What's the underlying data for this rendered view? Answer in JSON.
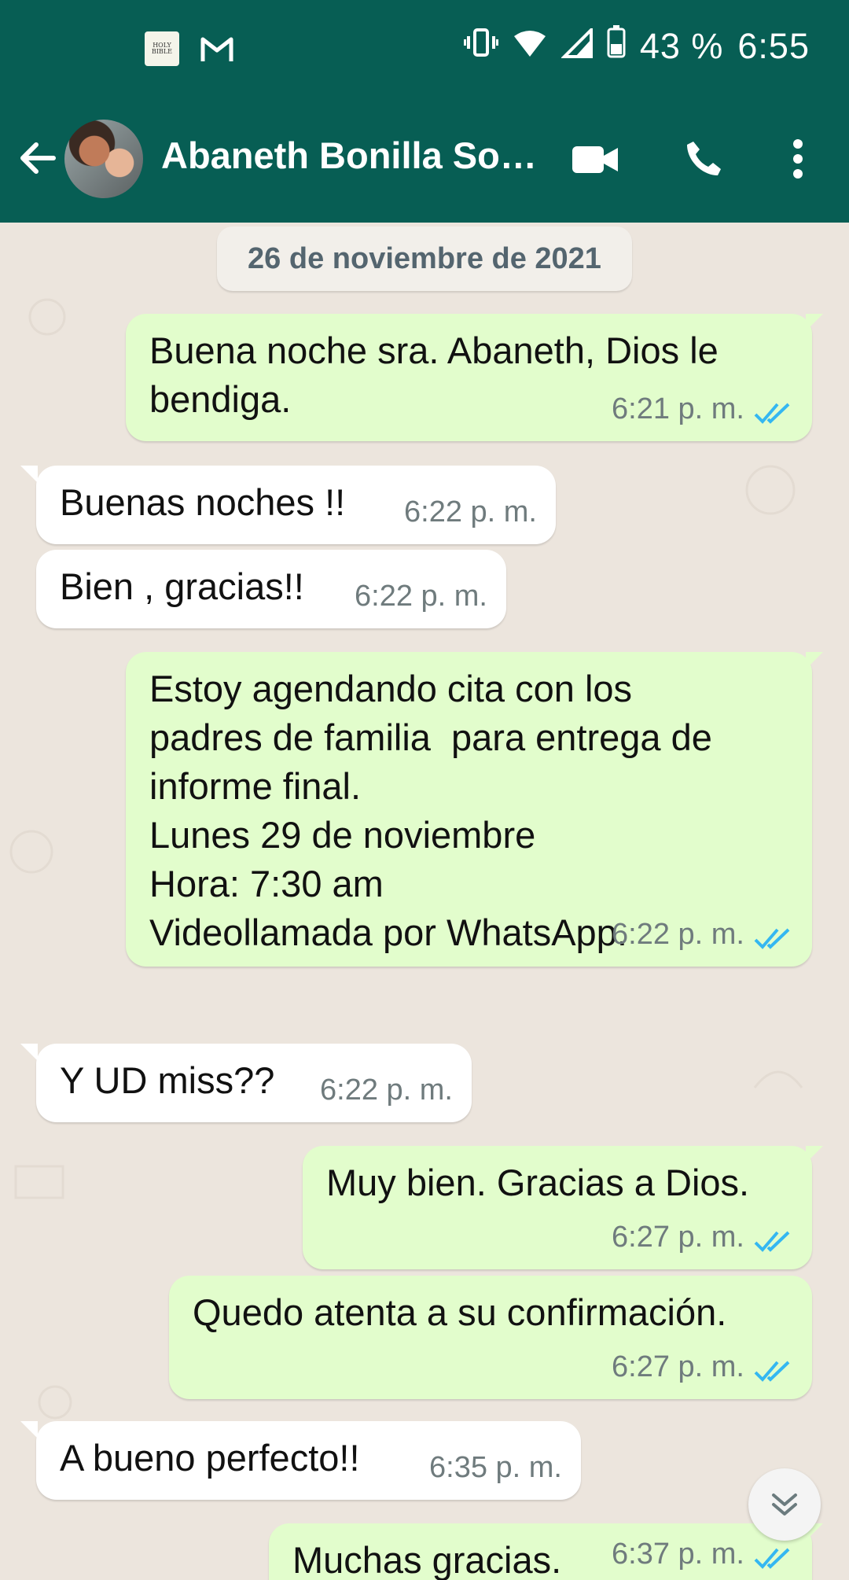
{
  "status_bar": {
    "battery": "43 %",
    "time": "6:55",
    "bible_icon_text": "HOLY BIBLE"
  },
  "header": {
    "contact_name": "Abaneth Bonilla So…"
  },
  "chat": {
    "date_chip": "26 de noviembre de 2021",
    "messages": [
      {
        "dir": "out",
        "text": "Buena noche sra. Abaneth, Dios le\nbendiga.",
        "time": "6:21 p. m.",
        "read": true
      },
      {
        "dir": "in",
        "text": "Buenas noches !!",
        "time": "6:22 p. m."
      },
      {
        "dir": "in",
        "text": "Bien , gracias!!",
        "time": "6:22 p. m."
      },
      {
        "dir": "out",
        "text": "Estoy agendando cita con los\npadres de familia  para entrega de\ninforme final.\nLunes 29 de noviembre\nHora: 7:30 am\nVideollamada por WhatsApp.",
        "time": "6:22 p. m.",
        "read": true
      },
      {
        "dir": "in",
        "text": "Y UD miss??",
        "time": "6:22 p. m."
      },
      {
        "dir": "out",
        "text": "Muy bien. Gracias a Dios.",
        "time": "6:27 p. m.",
        "read": true
      },
      {
        "dir": "out",
        "text": "Quedo atenta a su confirmación.",
        "time": "6:27 p. m.",
        "read": true
      },
      {
        "dir": "in",
        "text": "A bueno perfecto!!",
        "time": "6:35 p. m."
      },
      {
        "dir": "out",
        "text": "Muchas gracias.",
        "time": "6:37 p. m.",
        "read": true
      }
    ]
  },
  "colors": {
    "header": "#075e54",
    "outgoing_bubble": "#e2fdcc",
    "incoming_bubble": "#ffffff",
    "read_ticks": "#34b7f1",
    "chat_bg": "#ece5dd"
  }
}
